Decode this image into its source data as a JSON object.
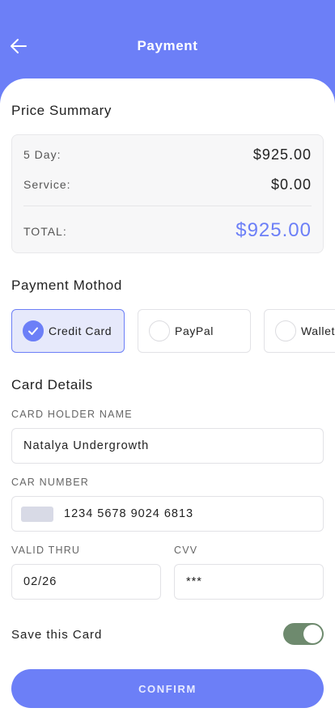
{
  "header": {
    "title": "Payment",
    "back_icon": "arrow-left-icon"
  },
  "price_summary": {
    "title": "Price Summary",
    "rows": [
      {
        "label": "5 Day:",
        "value": "$925.00"
      },
      {
        "label": "Service:",
        "value": "$0.00"
      }
    ],
    "total_label": "TOTAL:",
    "total_value": "$925.00"
  },
  "payment_method": {
    "title": "Payment Mothod",
    "options": [
      {
        "label": "Credit Card",
        "selected": true
      },
      {
        "label": "PayPal",
        "selected": false
      },
      {
        "label": "Wallet",
        "selected": false
      }
    ]
  },
  "card_details": {
    "title": "Card Details",
    "holder_label": "CARD HOLDER NAME",
    "holder_value": "Natalya Undergrowth",
    "number_label": "CAR NUMBER",
    "number_value": "1234 5678 9024 6813",
    "valid_label": "VALID THRU",
    "valid_value": "02/26",
    "cvv_label": "CVV",
    "cvv_value": "***"
  },
  "save_card": {
    "label": "Save this Card",
    "enabled": true
  },
  "confirm_label": "CONFIRM",
  "colors": {
    "accent": "#6c7ff7",
    "toggle_on": "#6e8a6e",
    "selected_bg": "#e6e9fb"
  }
}
